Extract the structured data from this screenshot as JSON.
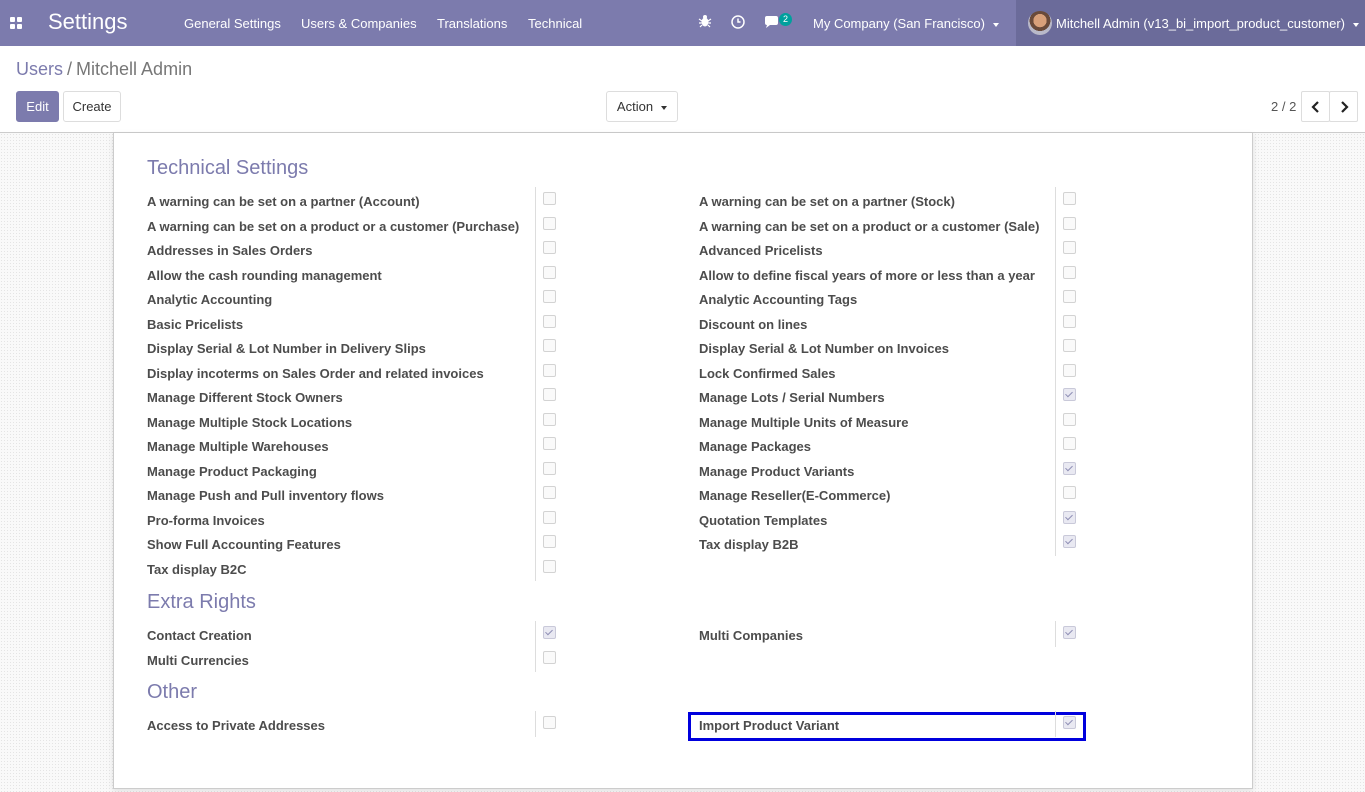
{
  "navbar": {
    "brand": "Settings",
    "menu": [
      "General Settings",
      "Users & Companies",
      "Translations",
      "Technical"
    ],
    "messages_count": "2",
    "company": "My Company (San Francisco)",
    "user": "Mitchell Admin (v13_bi_import_product_customer)"
  },
  "breadcrumb": {
    "parent": "Users",
    "separator": "/",
    "current": "Mitchell Admin"
  },
  "buttons": {
    "edit": "Edit",
    "create": "Create",
    "action": "Action"
  },
  "pager": {
    "value": "2 / 2"
  },
  "sections": {
    "technical": {
      "title": "Technical Settings",
      "left": [
        {
          "label": "A warning can be set on a partner (Account)",
          "checked": false
        },
        {
          "label": "A warning can be set on a product or a customer (Purchase)",
          "checked": false
        },
        {
          "label": "Addresses in Sales Orders",
          "checked": false
        },
        {
          "label": "Allow the cash rounding management",
          "checked": false
        },
        {
          "label": "Analytic Accounting",
          "checked": false
        },
        {
          "label": "Basic Pricelists",
          "checked": false
        },
        {
          "label": "Display Serial & Lot Number in Delivery Slips",
          "checked": false
        },
        {
          "label": "Display incoterms on Sales Order and related invoices",
          "checked": false
        },
        {
          "label": "Manage Different Stock Owners",
          "checked": false
        },
        {
          "label": "Manage Multiple Stock Locations",
          "checked": false
        },
        {
          "label": "Manage Multiple Warehouses",
          "checked": false
        },
        {
          "label": "Manage Product Packaging",
          "checked": false
        },
        {
          "label": "Manage Push and Pull inventory flows",
          "checked": false
        },
        {
          "label": "Pro-forma Invoices",
          "checked": false
        },
        {
          "label": "Show Full Accounting Features",
          "checked": false
        },
        {
          "label": "Tax display B2C",
          "checked": false
        }
      ],
      "right": [
        {
          "label": "A warning can be set on a partner (Stock)",
          "checked": false
        },
        {
          "label": "A warning can be set on a product or a customer (Sale)",
          "checked": false
        },
        {
          "label": "Advanced Pricelists",
          "checked": false
        },
        {
          "label": "Allow to define fiscal years of more or less than a year",
          "checked": false
        },
        {
          "label": "Analytic Accounting Tags",
          "checked": false
        },
        {
          "label": "Discount on lines",
          "checked": false
        },
        {
          "label": "Display Serial & Lot Number on Invoices",
          "checked": false
        },
        {
          "label": "Lock Confirmed Sales",
          "checked": false
        },
        {
          "label": "Manage Lots / Serial Numbers",
          "checked": true
        },
        {
          "label": "Manage Multiple Units of Measure",
          "checked": false
        },
        {
          "label": "Manage Packages",
          "checked": false
        },
        {
          "label": "Manage Product Variants",
          "checked": true
        },
        {
          "label": "Manage Reseller(E-Commerce)",
          "checked": false
        },
        {
          "label": "Quotation Templates",
          "checked": true
        },
        {
          "label": "Tax display B2B",
          "checked": true
        }
      ]
    },
    "extra_rights": {
      "title": "Extra Rights",
      "left": [
        {
          "label": "Contact Creation",
          "checked": true
        },
        {
          "label": "Multi Currencies",
          "checked": false
        }
      ],
      "right": [
        {
          "label": "Multi Companies",
          "checked": true
        }
      ]
    },
    "other": {
      "title": "Other",
      "left": [
        {
          "label": "Access to Private Addresses",
          "checked": false
        }
      ],
      "right": [
        {
          "label": "Import Product Variant",
          "checked": true
        }
      ]
    }
  },
  "colors": {
    "navbar": "#7c7bad",
    "accent": "#7c7bad",
    "highlight": "#0000dd"
  }
}
